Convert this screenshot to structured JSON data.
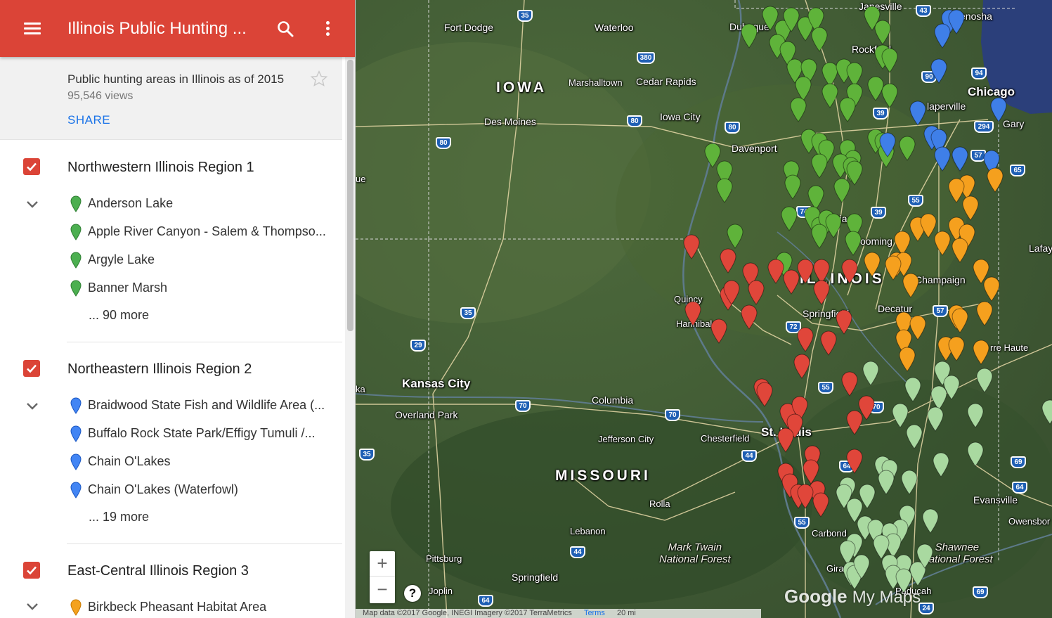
{
  "header": {
    "title": "Illinois Public Hunting ...",
    "menu_icon": "menu-icon",
    "search_icon": "search-icon",
    "more_icon": "more-vert-icon"
  },
  "summary": {
    "description": "Public hunting areas in Illinois as of 2015",
    "views": "95,546 views",
    "share_label": "SHARE",
    "star_icon": "star-outline-icon"
  },
  "layers": [
    {
      "title": "Northwestern Illinois Region 1",
      "pin_color": "#4caf50",
      "items": [
        "Anderson Lake",
        "Apple River Canyon - Salem & Thompso...",
        "Argyle Lake",
        "Banner Marsh"
      ],
      "more": "... 90 more"
    },
    {
      "title": "Northeastern Illinois Region 2",
      "pin_color": "#4285f4",
      "items": [
        "Braidwood State Fish and Wildlife Area (...",
        "Buffalo Rock State Park/Effigy Tumuli /...",
        "Chain O'Lakes",
        "Chain O'Lakes (Waterfowl)"
      ],
      "more": "... 19 more"
    },
    {
      "title": "East-Central Illinois Region 3",
      "pin_color": "#f4a21e",
      "items": [
        "Birkbeck Pheasant Habitat Area"
      ],
      "more": ""
    }
  ],
  "map": {
    "colors": {
      "region1": "#5fb33a",
      "region2": "#3f7fe8",
      "region3": "#f5a01e",
      "region4": "#e0463a",
      "region5": "#a9d9a0"
    },
    "states": {
      "iowa": "IOWA",
      "missouri": "MISSOURI",
      "illinois": "ILLINOIS"
    },
    "cities": {
      "fort_dodge": "Fort Dodge",
      "waterloo": "Waterloo",
      "dubuque": "Dubuque",
      "janesville": "Janesville",
      "kenosha": "enosha",
      "rockford": "Rockford",
      "chicago": "Chicago",
      "naperville": "laperville",
      "gary": "Gary",
      "marshalltown": "Marshalltown",
      "cedar_rapids": "Cedar Rapids",
      "des_moines": "Des Moines",
      "iowa_city": "Iowa City",
      "davenport": "Davenport",
      "peoria": "ria",
      "bloomington": "ooming",
      "champaign": "Champaign",
      "lafayette": "Lafay",
      "quincy": "Quincy",
      "hannibal": "Hannibal",
      "springfield_il": "Springfield",
      "decatur": "Decatur",
      "terre_haute": "rre Haute",
      "kansas_city": "Kansas City",
      "overland_park": "Overland Park",
      "columbia": "Columbia",
      "jefferson_city": "Jefferson City",
      "chesterfield": "Chesterfield",
      "st_louis": "St. Louis",
      "evansville": "Evansville",
      "owensboro": "Owensbor",
      "rolla": "Rolla",
      "lebanon": "Lebanon",
      "pittsburg": "Pittsburg",
      "springfield_mo": "Springfield",
      "joplin": "Joplin",
      "carbondale": "Carbond",
      "paducah": "Paducah",
      "girard": "Girard",
      "ue": "ue",
      "ka": "ka",
      "shawnee": "Shawnee\nNational Forest",
      "mark_twain": "Mark Twain\nNational Forest"
    },
    "highways": [
      "35",
      "380",
      "80",
      "80",
      "80",
      "35",
      "29",
      "35",
      "70",
      "70",
      "44",
      "44",
      "72",
      "55",
      "55",
      "55",
      "39",
      "39",
      "57",
      "57",
      "65",
      "94",
      "294",
      "43",
      "90",
      "64",
      "64",
      "69",
      "69",
      "24",
      "64",
      "70",
      "74",
      "55"
    ],
    "zoom_in": "+",
    "zoom_out": "−",
    "help": "?",
    "google_logo": "Google",
    "my_maps": "My Maps",
    "attribution": "Map data ©2017 Google, INEGI Imagery ©2017 TerraMetrics",
    "terms": "Terms",
    "scale": "20 mi"
  }
}
